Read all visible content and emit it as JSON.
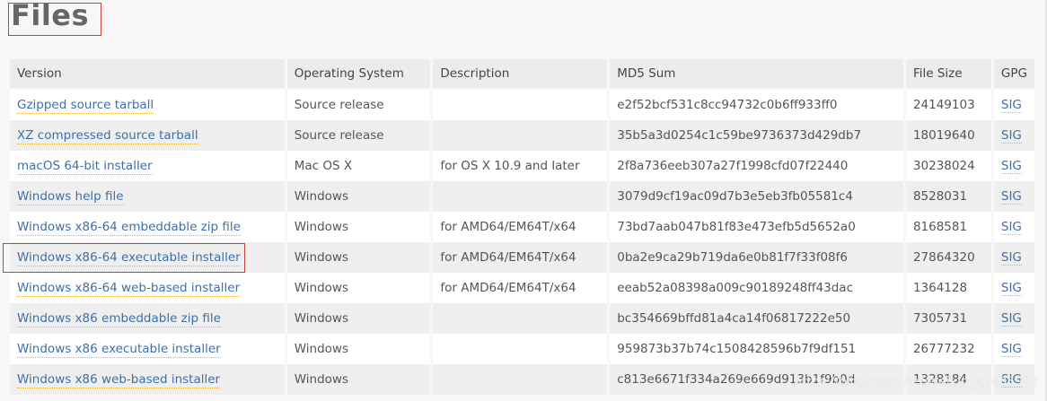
{
  "page": {
    "title": "Files"
  },
  "table": {
    "headers": [
      "Version",
      "Operating System",
      "Description",
      "MD5 Sum",
      "File Size",
      "GPG"
    ],
    "rows": [
      {
        "version": "Gzipped source tarball",
        "os": "Source release",
        "description": "",
        "md5": "e2f52bcf531c8cc94732c0b6ff933ff0",
        "size": "24149103",
        "gpg": "SIG"
      },
      {
        "version": "XZ compressed source tarball",
        "os": "Source release",
        "description": "",
        "md5": "35b5a3d0254c1c59be9736373d429db7",
        "size": "18019640",
        "gpg": "SIG"
      },
      {
        "version": "macOS 64-bit installer",
        "os": "Mac OS X",
        "description": "for OS X 10.9 and later",
        "md5": "2f8a736eeb307a27f1998cfd07f22440",
        "size": "30238024",
        "gpg": "SIG"
      },
      {
        "version": "Windows help file",
        "os": "Windows",
        "description": "",
        "md5": "3079d9cf19ac09d7b3e5eb3fb05581c4",
        "size": "8528031",
        "gpg": "SIG"
      },
      {
        "version": "Windows x86-64 embeddable zip file",
        "os": "Windows",
        "description": "for AMD64/EM64T/x64",
        "md5": "73bd7aab047b81f83e473efb5d5652a0",
        "size": "8168581",
        "gpg": "SIG"
      },
      {
        "version": "Windows x86-64 executable installer",
        "os": "Windows",
        "description": "for AMD64/EM64T/x64",
        "md5": "0ba2e9ca29b719da6e0b81f7f33f08f6",
        "size": "27864320",
        "gpg": "SIG"
      },
      {
        "version": "Windows x86-64 web-based installer",
        "os": "Windows",
        "description": "for AMD64/EM64T/x64",
        "md5": "eeab52a08398a009c90189248ff43dac",
        "size": "1364128",
        "gpg": "SIG"
      },
      {
        "version": "Windows x86 embeddable zip file",
        "os": "Windows",
        "description": "",
        "md5": "bc354669bffd81a4ca14f06817222e50",
        "size": "7305731",
        "gpg": "SIG"
      },
      {
        "version": "Windows x86 executable installer",
        "os": "Windows",
        "description": "",
        "md5": "959873b37b74c1508428596b7f9df151",
        "size": "26777232",
        "gpg": "SIG"
      },
      {
        "version": "Windows x86 web-based installer",
        "os": "Windows",
        "description": "",
        "md5": "c813e6671f334a269e669d913b1f9b0d",
        "size": "1328184",
        "gpg": "SIG"
      }
    ]
  },
  "watermark": "https://blog.csdn.net/weixin_42435987",
  "colors": {
    "link": "#3f6fa8",
    "annotation_box": "#d03b3b"
  }
}
